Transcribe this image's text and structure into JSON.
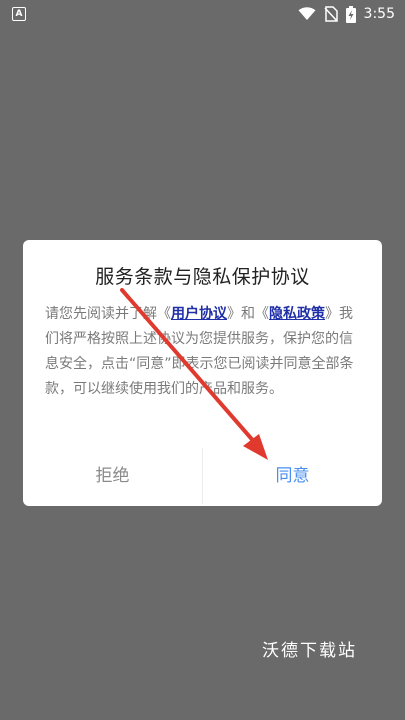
{
  "status_bar": {
    "app_badge": "A",
    "time": "3:55",
    "icons": [
      "wifi-icon",
      "no-sim-icon",
      "battery-charging-icon"
    ]
  },
  "dialog": {
    "title": "服务条款与隐私保护协议",
    "body": {
      "text_1": "请您先阅读并了解《",
      "link_user_agreement": "用户协议",
      "text_2": "》和《",
      "link_privacy_policy": "隐私政策",
      "text_3": "》我们将严格按照上述协议为您提供服务，保护您的信息安全，点击“同意”即表示您已阅读并同意全部条款，可以继续使用我们的产品和服务。"
    },
    "buttons": {
      "decline": "拒绝",
      "agree": "同意"
    }
  },
  "annotation": {
    "arrow_color": "#e03a2f",
    "arrow_icon": "red-arrow-icon"
  },
  "watermark": "沃德下载站"
}
